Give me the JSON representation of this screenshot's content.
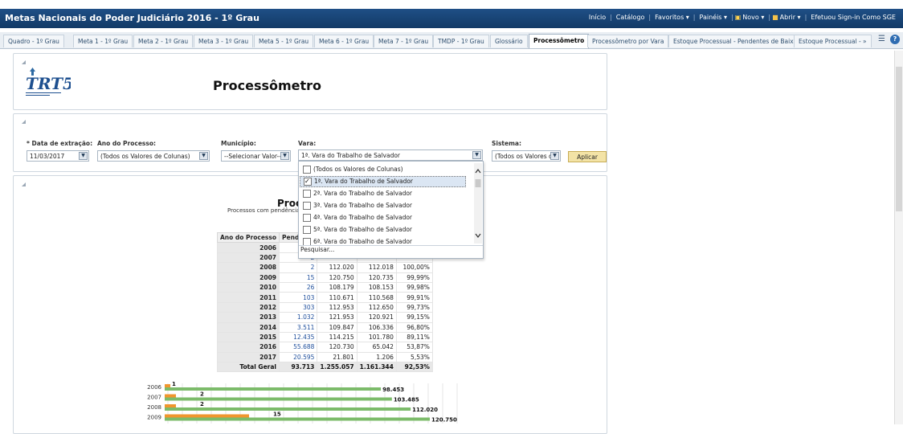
{
  "app": {
    "title": "Metas Nacionais do Poder Judiciário 2016 - 1º Grau",
    "nav": [
      "Início",
      "Catálogo",
      "Favoritos ▾",
      "Painéis ▾",
      "Novo ▾",
      "Abrir ▾",
      "Efetuou Sign-in Como SGE"
    ]
  },
  "tabs": [
    "Quadro - 1º Grau",
    "Meta 1 - 1º Grau",
    "Meta 2 - 1º Grau",
    "Meta 3 - 1º Grau",
    "Meta 5 - 1º Grau",
    "Meta 6 - 1º Grau",
    "Meta 7 - 1º Grau",
    "TMDP - 1º Grau",
    "Glossário",
    "Processômetro",
    "Processômetro por Vara",
    "Estoque Processual - Pendentes de Baixa",
    "Estoque Processual - »"
  ],
  "header": {
    "logo_text": "TRT5",
    "page_title": "Processômetro"
  },
  "filters": {
    "data_extracao": {
      "label": "* Data de extração:",
      "value": "11/03/2017"
    },
    "ano_processo": {
      "label": "Ano do Processo:",
      "value": "(Todos os Valores de Colunas)"
    },
    "municipio": {
      "label": "Município:",
      "value": "--Selecionar Valor--"
    },
    "vara": {
      "label": "Vara:",
      "value": "1ª. Vara do Trabalho de Salvador"
    },
    "sistema": {
      "label": "Sistema:",
      "value": "(Todos os Valores d"
    },
    "apply_label": "Aplicar"
  },
  "vara_dropdown": {
    "items": [
      {
        "label": "(Todos os Valores de Colunas)",
        "checked": false
      },
      {
        "label": "1ª. Vara do Trabalho de Salvador",
        "checked": true
      },
      {
        "label": "2ª. Vara do Trabalho de Salvador",
        "checked": false
      },
      {
        "label": "3ª. Vara do Trabalho de Salvador",
        "checked": false
      },
      {
        "label": "4ª. Vara do Trabalho de Salvador",
        "checked": false
      },
      {
        "label": "5ª. Vara do Trabalho de Salvador",
        "checked": false
      },
      {
        "label": "6ª. Vara do Trabalho de Salvador",
        "checked": false
      }
    ],
    "search_label": "Pesquisar..."
  },
  "report": {
    "title": "Proc",
    "subtitle": "Processos com pendência",
    "columns": [
      "Ano do Processo",
      "Pendente",
      "D"
    ],
    "rows": [
      {
        "ano": "2006",
        "pendente": "1",
        "distribuidos": "",
        "baixados": "",
        "percentual": ""
      },
      {
        "ano": "2007",
        "pendente": "2",
        "distribuidos": "",
        "baixados": "",
        "percentual": ""
      },
      {
        "ano": "2008",
        "pendente": "2",
        "distribuidos": "112.020",
        "baixados": "112.018",
        "percentual": "100,00%"
      },
      {
        "ano": "2009",
        "pendente": "15",
        "distribuidos": "120.750",
        "baixados": "120.735",
        "percentual": "99,99%"
      },
      {
        "ano": "2010",
        "pendente": "26",
        "distribuidos": "108.179",
        "baixados": "108.153",
        "percentual": "99,98%"
      },
      {
        "ano": "2011",
        "pendente": "103",
        "distribuidos": "110.671",
        "baixados": "110.568",
        "percentual": "99,91%"
      },
      {
        "ano": "2012",
        "pendente": "303",
        "distribuidos": "112.953",
        "baixados": "112.650",
        "percentual": "99,73%"
      },
      {
        "ano": "2013",
        "pendente": "1.032",
        "distribuidos": "121.953",
        "baixados": "120.921",
        "percentual": "99,15%"
      },
      {
        "ano": "2014",
        "pendente": "3.511",
        "distribuidos": "109.847",
        "baixados": "106.336",
        "percentual": "96,80%"
      },
      {
        "ano": "2015",
        "pendente": "12.435",
        "distribuidos": "114.215",
        "baixados": "101.780",
        "percentual": "89,11%"
      },
      {
        "ano": "2016",
        "pendente": "55.688",
        "distribuidos": "120.730",
        "baixados": "65.042",
        "percentual": "53,87%"
      },
      {
        "ano": "2017",
        "pendente": "20.595",
        "distribuidos": "21.801",
        "baixados": "1.206",
        "percentual": "5,53%"
      }
    ],
    "total": {
      "ano": "Total Geral",
      "pendente": "93.713",
      "distribuidos": "1.255.057",
      "baixados": "1.161.344",
      "percentual": "92,53%"
    }
  },
  "chart_data": {
    "type": "bar",
    "orientation": "horizontal",
    "categories": [
      "2006",
      "2007",
      "2008",
      "2009"
    ],
    "series": [
      {
        "values": [
          1,
          2,
          2,
          15
        ],
        "labels": [
          "1",
          "2",
          "2",
          "15"
        ],
        "color": "#f0962e"
      },
      {
        "values": [
          98453,
          103485,
          112020,
          120750
        ],
        "labels": [
          "98.453",
          "103.485",
          "112.020",
          "120.750"
        ],
        "color": "#7cbb6a"
      }
    ]
  }
}
